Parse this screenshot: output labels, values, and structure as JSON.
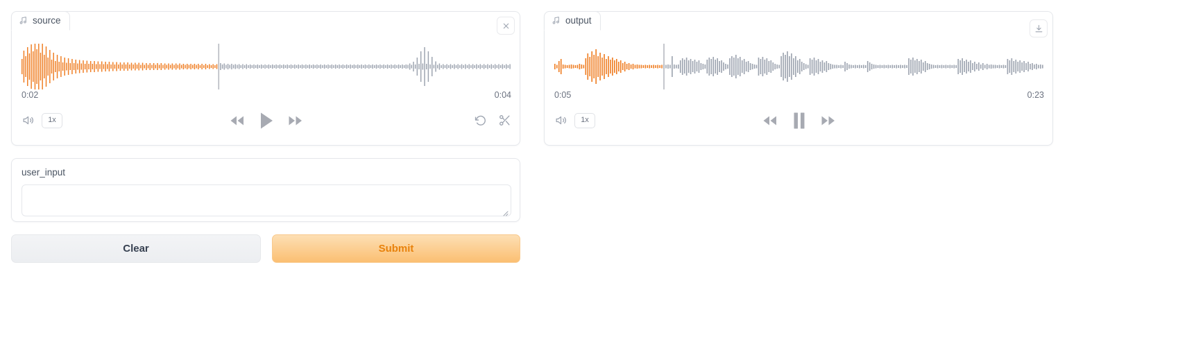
{
  "app": {
    "background": "#ffffff",
    "accent": "#e8820c",
    "waveform_played_color": "#ef7d22",
    "waveform_unplayed_color": "#9ca3af",
    "cursor_color": "#b6b9c0"
  },
  "source_panel": {
    "tab_label": "source",
    "tab_icon": "music-note-icon",
    "close_icon": "close-icon",
    "time_current": "0:02",
    "time_total": "0:04",
    "volume_icon": "volume-icon",
    "speed_label": "1x",
    "rewind_icon": "rewind-icon",
    "play_icon": "play-icon",
    "forward_icon": "forward-icon",
    "undo_icon": "undo-icon",
    "trim_icon": "scissors-icon",
    "playhead_percent": 40,
    "waveform": {
      "played_bars": [
        22,
        46,
        30,
        56,
        38,
        64,
        44,
        72,
        50,
        80,
        40,
        70,
        34,
        58,
        26,
        48,
        20,
        40,
        16,
        34,
        14,
        30,
        12,
        26,
        11,
        24,
        10,
        22,
        10,
        20,
        9,
        19,
        9,
        18,
        8,
        17,
        8,
        16,
        8,
        16,
        7,
        15,
        7,
        15,
        7,
        14,
        7,
        14,
        6,
        13,
        6,
        13,
        6,
        12,
        6,
        12,
        6,
        12,
        6,
        11,
        6,
        11,
        6,
        11,
        5,
        11,
        5,
        10,
        5,
        10,
        5,
        10,
        5,
        10,
        5,
        10,
        5,
        9,
        5,
        9,
        5,
        9,
        5,
        9,
        5,
        9,
        5,
        8,
        5,
        8,
        5,
        8,
        5,
        8,
        5,
        8,
        4,
        8,
        4,
        8,
        4,
        7,
        4,
        7,
        4,
        7
      ],
      "unplayed_bars": [
        6,
        10,
        6,
        9,
        5,
        8,
        5,
        8,
        5,
        7,
        5,
        7,
        4,
        7,
        4,
        7,
        4,
        6,
        4,
        6,
        4,
        6,
        4,
        6,
        4,
        6,
        4,
        6,
        4,
        6,
        4,
        6,
        4,
        6,
        4,
        6,
        4,
        6,
        4,
        6,
        4,
        6,
        4,
        6,
        4,
        6,
        4,
        6,
        4,
        6,
        4,
        6,
        4,
        6,
        4,
        6,
        4,
        6,
        4,
        6,
        4,
        6,
        4,
        6,
        4,
        6,
        4,
        6,
        4,
        6,
        4,
        6,
        4,
        6,
        4,
        6,
        4,
        6,
        4,
        6,
        4,
        6,
        4,
        6,
        4,
        6,
        4,
        6,
        4,
        6,
        4,
        6,
        4,
        6,
        4,
        6,
        4,
        6,
        4,
        6,
        4,
        6,
        5,
        9,
        5,
        14,
        6,
        26,
        8,
        44,
        9,
        56,
        8,
        44,
        6,
        28,
        5,
        15,
        5,
        9,
        4,
        7,
        4,
        7,
        4,
        7,
        4,
        7,
        4,
        7,
        4,
        7,
        4,
        7,
        4,
        7,
        4,
        7,
        4,
        7,
        4,
        7,
        4,
        7,
        4,
        7,
        4,
        7,
        4,
        7,
        4,
        7,
        4,
        7,
        4,
        7,
        4,
        7
      ]
    }
  },
  "output_panel": {
    "tab_label": "output",
    "tab_icon": "music-note-icon",
    "download_icon": "download-icon",
    "time_current": "0:05",
    "time_total": "0:23",
    "volume_icon": "volume-icon",
    "speed_label": "1x",
    "rewind_icon": "rewind-icon",
    "pause_icon": "pause-icon",
    "forward_icon": "forward-icon",
    "playhead_percent": 18,
    "waveform": {
      "played_bars": [
        8,
        5,
        16,
        22,
        6,
        5,
        4,
        5,
        6,
        5,
        4,
        5,
        8,
        6,
        5,
        24,
        38,
        28,
        44,
        34,
        50,
        30,
        40,
        26,
        36,
        22,
        30,
        20,
        26,
        18,
        22,
        14,
        18,
        10,
        14,
        8,
        10,
        6,
        8,
        5,
        6,
        5,
        5,
        4,
        5,
        4,
        5,
        4,
        5,
        4,
        5,
        4,
        5
      ],
      "unplayed_bars": [
        6,
        5,
        6,
        5,
        30,
        6,
        5,
        6,
        18,
        24,
        20,
        26,
        18,
        22,
        16,
        20,
        14,
        18,
        10,
        8,
        6,
        20,
        26,
        22,
        28,
        20,
        24,
        16,
        18,
        12,
        8,
        6,
        24,
        30,
        26,
        34,
        24,
        28,
        18,
        22,
        14,
        16,
        10,
        8,
        6,
        5,
        26,
        22,
        28,
        20,
        24,
        16,
        18,
        12,
        8,
        6,
        5,
        30,
        40,
        34,
        44,
        30,
        38,
        24,
        30,
        18,
        22,
        14,
        10,
        7,
        5,
        24,
        20,
        26,
        18,
        22,
        14,
        18,
        12,
        16,
        10,
        8,
        6,
        5,
        5,
        4,
        5,
        4,
        14,
        10,
        6,
        5,
        4,
        5,
        4,
        5,
        4,
        5,
        4,
        16,
        12,
        8,
        6,
        5,
        4,
        5,
        4,
        5,
        4,
        5,
        4,
        5,
        4,
        5,
        4,
        5,
        4,
        5,
        4,
        24,
        20,
        26,
        18,
        22,
        16,
        20,
        12,
        16,
        10,
        8,
        6,
        5,
        4,
        5,
        4,
        5,
        4,
        5,
        4,
        5,
        4,
        5,
        4,
        22,
        18,
        24,
        16,
        20,
        14,
        18,
        10,
        14,
        8,
        12,
        6,
        10,
        5,
        8,
        5,
        6,
        5,
        5,
        4,
        5,
        4,
        5,
        4,
        22,
        18,
        24,
        16,
        20,
        14,
        18,
        12,
        16,
        10,
        14,
        8,
        10,
        6,
        8,
        5,
        6,
        5
      ]
    }
  },
  "input_block": {
    "label": "user_input",
    "textarea_value": "",
    "textarea_placeholder": ""
  },
  "actions": {
    "clear_label": "Clear",
    "submit_label": "Submit"
  }
}
